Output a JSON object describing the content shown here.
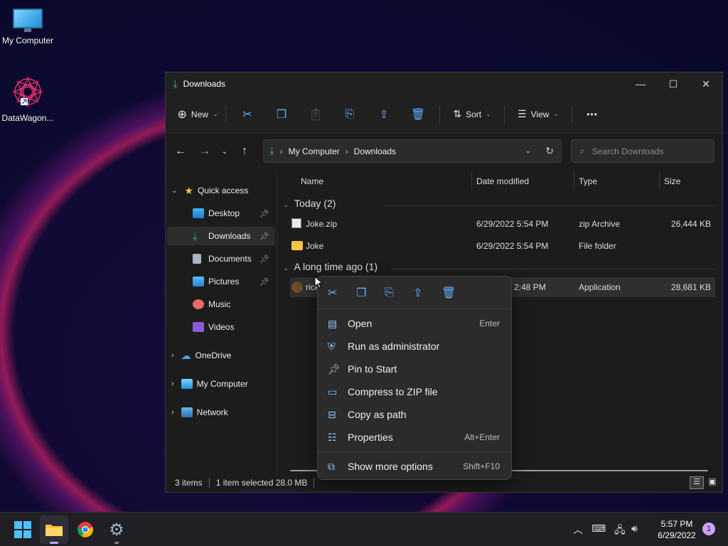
{
  "desktop": {
    "icons": [
      {
        "label": "My Computer"
      },
      {
        "label": "DataWagon..."
      }
    ]
  },
  "window": {
    "title": "Downloads",
    "controls": {
      "minimize": "—",
      "maximize": "☐",
      "close": "✕"
    },
    "toolbar": {
      "new_label": "New",
      "sort_label": "Sort",
      "view_label": "View",
      "more_label": "•••"
    },
    "address": {
      "crumbs": [
        "My Computer",
        "Downloads"
      ],
      "search_placeholder": "Search Downloads"
    },
    "sidebar": {
      "quick_access": "Quick access",
      "items": [
        {
          "label": "Desktop"
        },
        {
          "label": "Downloads"
        },
        {
          "label": "Documents"
        },
        {
          "label": "Pictures"
        },
        {
          "label": "Music"
        },
        {
          "label": "Videos"
        }
      ],
      "onedrive": "OneDrive",
      "my_computer": "My Computer",
      "network": "Network"
    },
    "columns": [
      "Name",
      "Date modified",
      "Type",
      "Size"
    ],
    "groups": [
      {
        "label": "Today (2)",
        "rows": [
          {
            "name": "Joke.zip",
            "date": "6/29/2022 5:54 PM",
            "type": "zip Archive",
            "size": "26,444 KB"
          },
          {
            "name": "Joke",
            "date": "6/29/2022 5:54 PM",
            "type": "File folder",
            "size": ""
          }
        ]
      },
      {
        "label": "A long time ago (1)",
        "rows": [
          {
            "name": "rick",
            "date": "2:48 PM",
            "type": "Application",
            "size": "28,681 KB"
          }
        ]
      }
    ],
    "status": {
      "count": "3 items",
      "selected": "1 item selected  28.0 MB"
    }
  },
  "context_menu": {
    "items": [
      {
        "label": "Open",
        "shortcut": "Enter",
        "icon": "open-icon"
      },
      {
        "label": "Run as administrator",
        "shortcut": "",
        "icon": "shield-icon"
      },
      {
        "label": "Pin to Start",
        "shortcut": "",
        "icon": "pin-icon"
      },
      {
        "label": "Compress to ZIP file",
        "shortcut": "",
        "icon": "zip-icon"
      },
      {
        "label": "Copy as path",
        "shortcut": "",
        "icon": "path-icon"
      },
      {
        "label": "Properties",
        "shortcut": "Alt+Enter",
        "icon": "properties-icon"
      },
      {
        "label": "Show more options",
        "shortcut": "Shift+F10",
        "icon": "more-options-icon"
      }
    ]
  },
  "taskbar": {
    "time": "5:57 PM",
    "date": "6/29/2022",
    "notifications": "1"
  },
  "colors": {
    "accent": "#60b0ff",
    "folder": "#f5c542",
    "download_green": "#3fb96b"
  }
}
